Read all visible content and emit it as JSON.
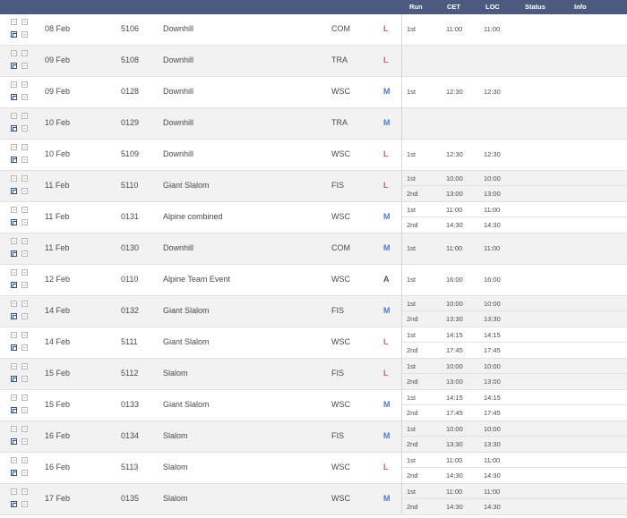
{
  "header": {
    "run": "Run",
    "cet": "CET",
    "loc": "LOC",
    "status": "Status",
    "info": "Info"
  },
  "colors": {
    "header_bg": "#4c5a80",
    "gender_L": "#e05a6a",
    "gender_M": "#4a7ad2",
    "gender_A": "#555555"
  },
  "icons": [
    "plus-box-icon",
    "minus-box-icon",
    "calendar-icon",
    "info-box-icon"
  ],
  "rows": [
    {
      "date": "08 Feb",
      "code": "5106",
      "discipline": "Downhill",
      "category": "COM",
      "gender": "L",
      "runs": [
        {
          "run": "1st",
          "cet": "11:00",
          "loc": "11:00"
        }
      ]
    },
    {
      "date": "09 Feb",
      "code": "5108",
      "discipline": "Downhill",
      "category": "TRA",
      "gender": "L",
      "runs": []
    },
    {
      "date": "09 Feb",
      "code": "0128",
      "discipline": "Downhill",
      "category": "WSC",
      "gender": "M",
      "runs": [
        {
          "run": "1st",
          "cet": "12:30",
          "loc": "12:30"
        }
      ]
    },
    {
      "date": "10 Feb",
      "code": "0129",
      "discipline": "Downhill",
      "category": "TRA",
      "gender": "M",
      "runs": []
    },
    {
      "date": "10 Feb",
      "code": "5109",
      "discipline": "Downhill",
      "category": "WSC",
      "gender": "L",
      "runs": [
        {
          "run": "1st",
          "cet": "12:30",
          "loc": "12:30"
        }
      ]
    },
    {
      "date": "11 Feb",
      "code": "5110",
      "discipline": "Giant Slalom",
      "category": "FIS",
      "gender": "L",
      "runs": [
        {
          "run": "1st",
          "cet": "10:00",
          "loc": "10:00"
        },
        {
          "run": "2nd",
          "cet": "13:00",
          "loc": "13:00"
        }
      ]
    },
    {
      "date": "11 Feb",
      "code": "0131",
      "discipline": "Alpine combined",
      "category": "WSC",
      "gender": "M",
      "runs": [
        {
          "run": "1st",
          "cet": "11:00",
          "loc": "11:00"
        },
        {
          "run": "2nd",
          "cet": "14:30",
          "loc": "14:30"
        }
      ]
    },
    {
      "date": "11 Feb",
      "code": "0130",
      "discipline": "Downhill",
      "category": "COM",
      "gender": "M",
      "runs": [
        {
          "run": "1st",
          "cet": "11:00",
          "loc": "11:00"
        }
      ]
    },
    {
      "date": "12 Feb",
      "code": "0110",
      "discipline": "Alpine Team Event",
      "category": "WSC",
      "gender": "A",
      "runs": [
        {
          "run": "1st",
          "cet": "16:00",
          "loc": "16:00"
        }
      ]
    },
    {
      "date": "14 Feb",
      "code": "0132",
      "discipline": "Giant Slalom",
      "category": "FIS",
      "gender": "M",
      "runs": [
        {
          "run": "1st",
          "cet": "10:00",
          "loc": "10:00"
        },
        {
          "run": "2nd",
          "cet": "13:30",
          "loc": "13:30"
        }
      ]
    },
    {
      "date": "14 Feb",
      "code": "5111",
      "discipline": "Giant Slalom",
      "category": "WSC",
      "gender": "L",
      "runs": [
        {
          "run": "1st",
          "cet": "14:15",
          "loc": "14:15"
        },
        {
          "run": "2nd",
          "cet": "17:45",
          "loc": "17:45"
        }
      ]
    },
    {
      "date": "15 Feb",
      "code": "5112",
      "discipline": "Slalom",
      "category": "FIS",
      "gender": "L",
      "runs": [
        {
          "run": "1st",
          "cet": "10:00",
          "loc": "10:00"
        },
        {
          "run": "2nd",
          "cet": "13:00",
          "loc": "13:00"
        }
      ]
    },
    {
      "date": "15 Feb",
      "code": "0133",
      "discipline": "Giant Slalom",
      "category": "WSC",
      "gender": "M",
      "runs": [
        {
          "run": "1st",
          "cet": "14:15",
          "loc": "14:15"
        },
        {
          "run": "2nd",
          "cet": "17:45",
          "loc": "17:45"
        }
      ]
    },
    {
      "date": "16 Feb",
      "code": "0134",
      "discipline": "Slalom",
      "category": "FIS",
      "gender": "M",
      "runs": [
        {
          "run": "1st",
          "cet": "10:00",
          "loc": "10:00"
        },
        {
          "run": "2nd",
          "cet": "13:30",
          "loc": "13:30"
        }
      ]
    },
    {
      "date": "16 Feb",
      "code": "5113",
      "discipline": "Slalom",
      "category": "WSC",
      "gender": "L",
      "runs": [
        {
          "run": "1st",
          "cet": "11:00",
          "loc": "11:00"
        },
        {
          "run": "2nd",
          "cet": "14:30",
          "loc": "14:30"
        }
      ]
    },
    {
      "date": "17 Feb",
      "code": "0135",
      "discipline": "Slalom",
      "category": "WSC",
      "gender": "M",
      "runs": [
        {
          "run": "1st",
          "cet": "11:00",
          "loc": "11:00"
        },
        {
          "run": "2nd",
          "cet": "14:30",
          "loc": "14:30"
        }
      ]
    }
  ]
}
